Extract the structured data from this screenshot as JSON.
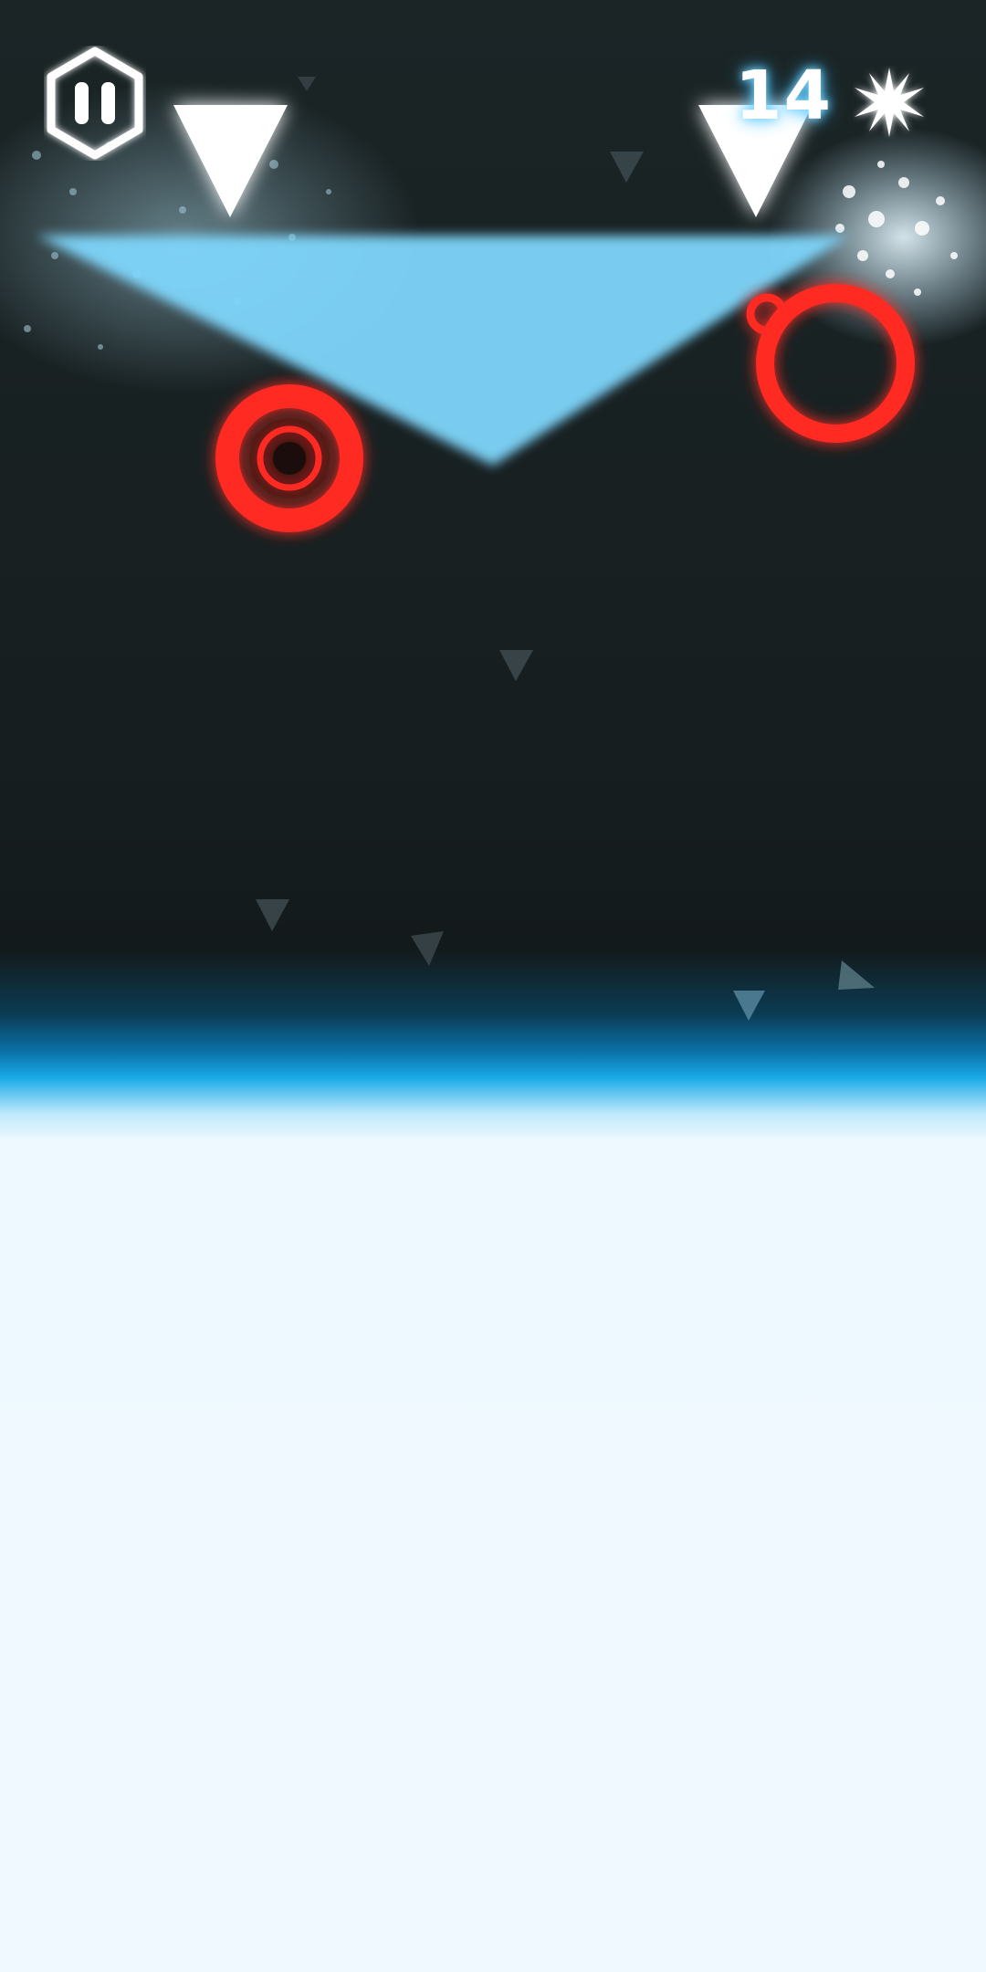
{
  "hud": {
    "score": "14",
    "pause_icon": "pause-icon",
    "star_icon": "star-burst-icon"
  },
  "colors": {
    "background_top": "#1b2526",
    "light_floor": "#f0f9ff",
    "glow_blue": "#7fd8ff",
    "ring_red": "#ff2a24",
    "beam_blue": "#7fd6fb",
    "hud_white": "#ffffff"
  },
  "game": {
    "enemies": [
      "red-ring",
      "red-ring"
    ],
    "spikes": [
      "white-triangle-spike",
      "white-triangle-spike"
    ],
    "player_beam": "light-blue-triangle-beam"
  }
}
